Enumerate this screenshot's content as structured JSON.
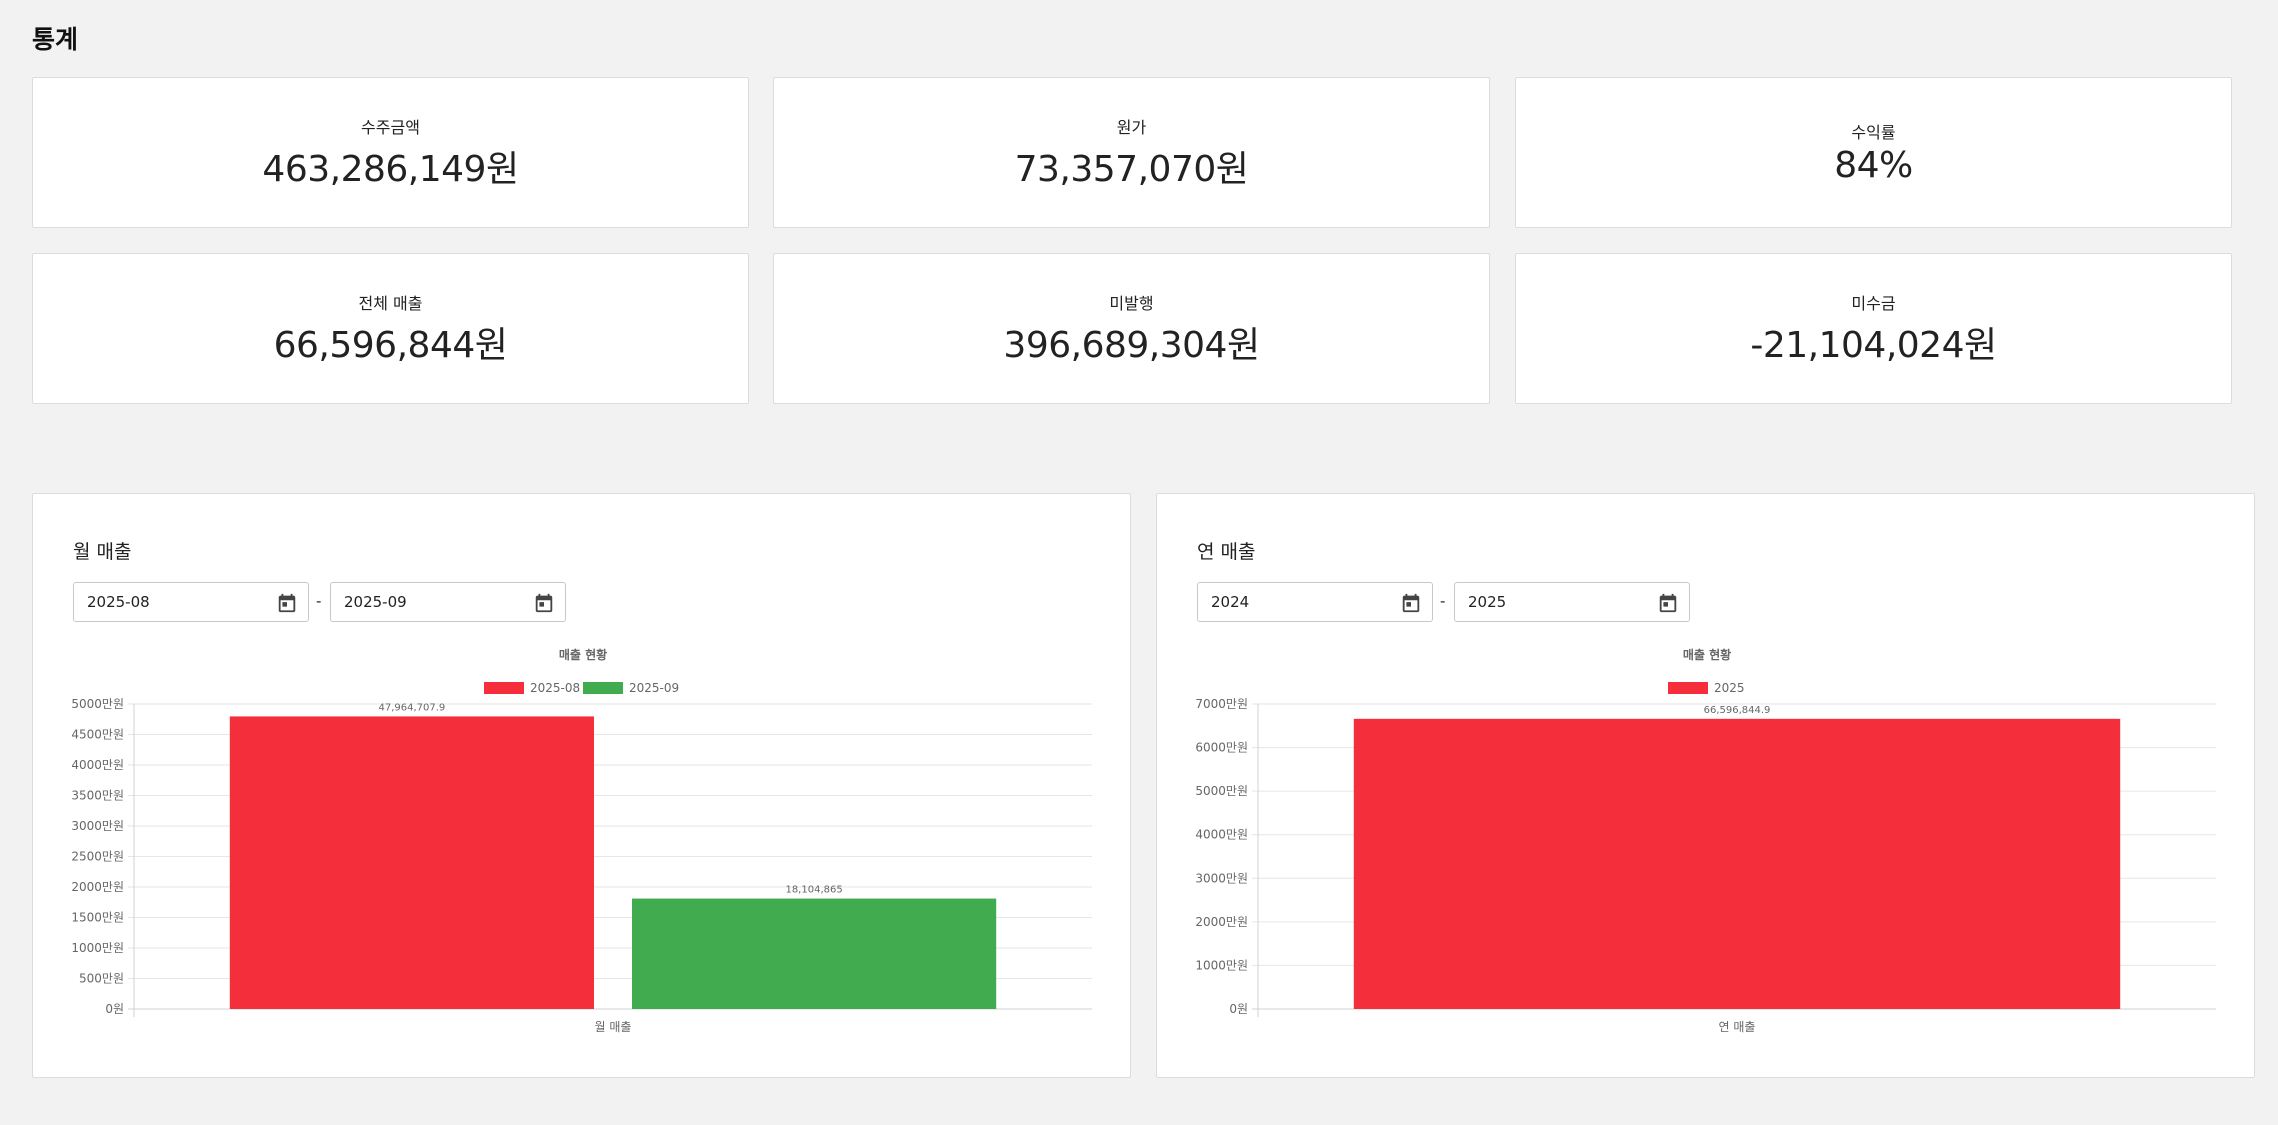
{
  "page": {
    "title": "통계"
  },
  "stats": [
    {
      "label": "수주금액",
      "value": "463,286,149원"
    },
    {
      "label": "원가",
      "value": "73,357,070원"
    },
    {
      "label": "수익률",
      "value": "84%"
    },
    {
      "label": "전체 매출",
      "value": "66,596,844원"
    },
    {
      "label": "미발행",
      "value": "396,689,304원"
    },
    {
      "label": "미수금",
      "value": "-21,104,024원"
    }
  ],
  "monthly": {
    "title": "월 매출",
    "start_date": "2025-08",
    "end_date": "2025-09",
    "separator": "-"
  },
  "yearly": {
    "title": "연 매출",
    "start_date": "2024",
    "end_date": "2025",
    "separator": "-"
  },
  "icons": {
    "date_picker": "calendar-icon"
  },
  "chart_data": [
    {
      "type": "bar",
      "title": "매출 현황",
      "xlabel": "월 매출",
      "categories": [
        "월 매출"
      ],
      "series": [
        {
          "name": "2025-08",
          "values": [
            47964707.9
          ],
          "label": "47,964,707.9",
          "color": "#f42e3a"
        },
        {
          "name": "2025-09",
          "values": [
            18104865
          ],
          "label": "18,104,865",
          "color": "#41ab4f"
        }
      ],
      "ylim": [
        0,
        50000000
      ],
      "yticks": [
        0,
        5000000,
        10000000,
        15000000,
        20000000,
        25000000,
        30000000,
        35000000,
        40000000,
        45000000,
        50000000
      ],
      "ytick_labels": [
        "0원",
        "500만원",
        "1000만원",
        "1500만원",
        "2000만원",
        "2500만원",
        "3000만원",
        "3500만원",
        "4000만원",
        "4500만원",
        "5000만원"
      ],
      "legend": "top",
      "grid": true
    },
    {
      "type": "bar",
      "title": "매출 현황",
      "xlabel": "연 매출",
      "categories": [
        "연 매출"
      ],
      "series": [
        {
          "name": "2025",
          "values": [
            66596844.9
          ],
          "label": "66,596,844.9",
          "color": "#f42e3a"
        }
      ],
      "ylim": [
        0,
        70000000
      ],
      "yticks": [
        0,
        10000000,
        20000000,
        30000000,
        40000000,
        50000000,
        60000000,
        70000000
      ],
      "ytick_labels": [
        "0원",
        "1000만원",
        "2000만원",
        "3000만원",
        "4000만원",
        "5000만원",
        "6000만원",
        "7000만원"
      ],
      "legend": "top",
      "grid": true
    }
  ]
}
